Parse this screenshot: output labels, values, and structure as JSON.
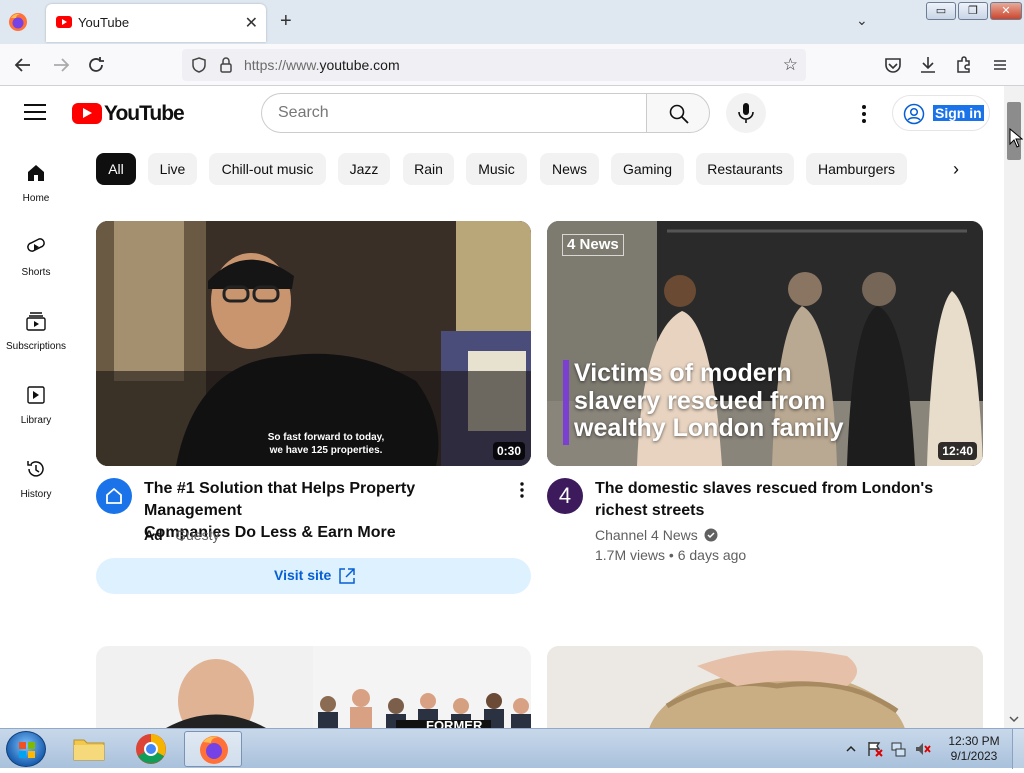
{
  "browser": {
    "tab_title": "YouTube",
    "tab_close": "✕",
    "new_tab": "+",
    "tab_list": "⌄",
    "url_prefix": "https://www.",
    "url_domain": "youtube.com",
    "window_controls": {
      "minimize": "▭",
      "maximize": "❐",
      "close": "✕"
    }
  },
  "masthead": {
    "logo_text": "YouTube",
    "search_placeholder": "Search",
    "sign_in_label": "Sign in"
  },
  "guide": {
    "items": [
      {
        "label": "Home"
      },
      {
        "label": "Shorts"
      },
      {
        "label": "Subscriptions"
      },
      {
        "label": "Library"
      },
      {
        "label": "History"
      }
    ]
  },
  "chips": [
    "All",
    "Live",
    "Chill-out music",
    "Jazz",
    "Rain",
    "Music",
    "News",
    "Gaming",
    "Restaurants",
    "Hamburgers"
  ],
  "chips_next": "›",
  "videos": [
    {
      "title_line1": "The #1 Solution that Helps Property Management",
      "title_line2": "Companies Do Less & Earn More",
      "badge": "Ad",
      "channel": "· Guesty",
      "duration": "0:30",
      "thumb_caption_line1": "So fast forward to today,",
      "thumb_caption_line2": "we have 125 properties.",
      "cta_label": "Visit site"
    },
    {
      "title_line1": "The domestic slaves rescued from London's",
      "title_line2": "richest streets",
      "channel": "Channel 4 News",
      "stats": "1.7M views • 6 days ago",
      "duration": "12:40",
      "thumb_brand": "News",
      "thumb_brand_num": "4",
      "thumb_headline_line1": "Victims of modern",
      "thumb_headline_line2": "slavery rescued from",
      "thumb_headline_line3": "wealthy London family",
      "channel_avatar_text": "4"
    },
    {
      "thumb_overlay": "FORMER"
    }
  ],
  "taskbar": {
    "time": "12:30 PM",
    "date": "9/1/2023"
  }
}
